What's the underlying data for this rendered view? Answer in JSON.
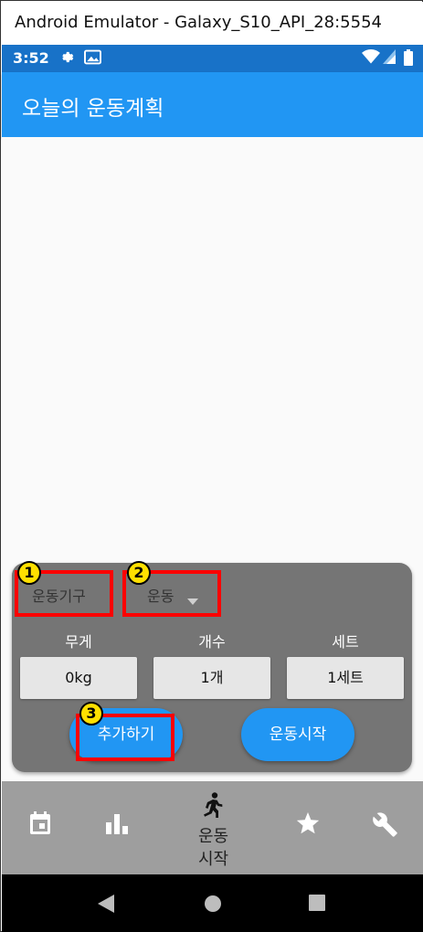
{
  "window": {
    "title": "Android Emulator - Galaxy_S10_API_28:5554"
  },
  "status_bar": {
    "time": "3:52"
  },
  "app_bar": {
    "title": "오늘의 운동계획"
  },
  "panel": {
    "equipment_label": "운동기구",
    "exercise_dropdown": {
      "selected": "운동"
    },
    "columns": [
      {
        "label": "무게",
        "value": "0kg"
      },
      {
        "label": "개수",
        "value": "1개"
      },
      {
        "label": "세트",
        "value": "1세트"
      }
    ],
    "add_button": "추가하기",
    "start_button": "운동시작"
  },
  "annotations": [
    "1",
    "2",
    "3"
  ],
  "bottom_nav": {
    "items": [
      {
        "icon": "calendar-icon"
      },
      {
        "icon": "bar-chart-icon"
      },
      {
        "icon": "running-icon",
        "label_line1": "운동",
        "label_line2": "시작",
        "active": true
      },
      {
        "icon": "star-icon"
      },
      {
        "icon": "wrench-icon"
      }
    ]
  },
  "colors": {
    "primary": "#2196f3",
    "status_bar": "#1872c8",
    "panel": "#757575",
    "annotation_box": "#ff0000",
    "annotation_badge": "#ffe000"
  }
}
